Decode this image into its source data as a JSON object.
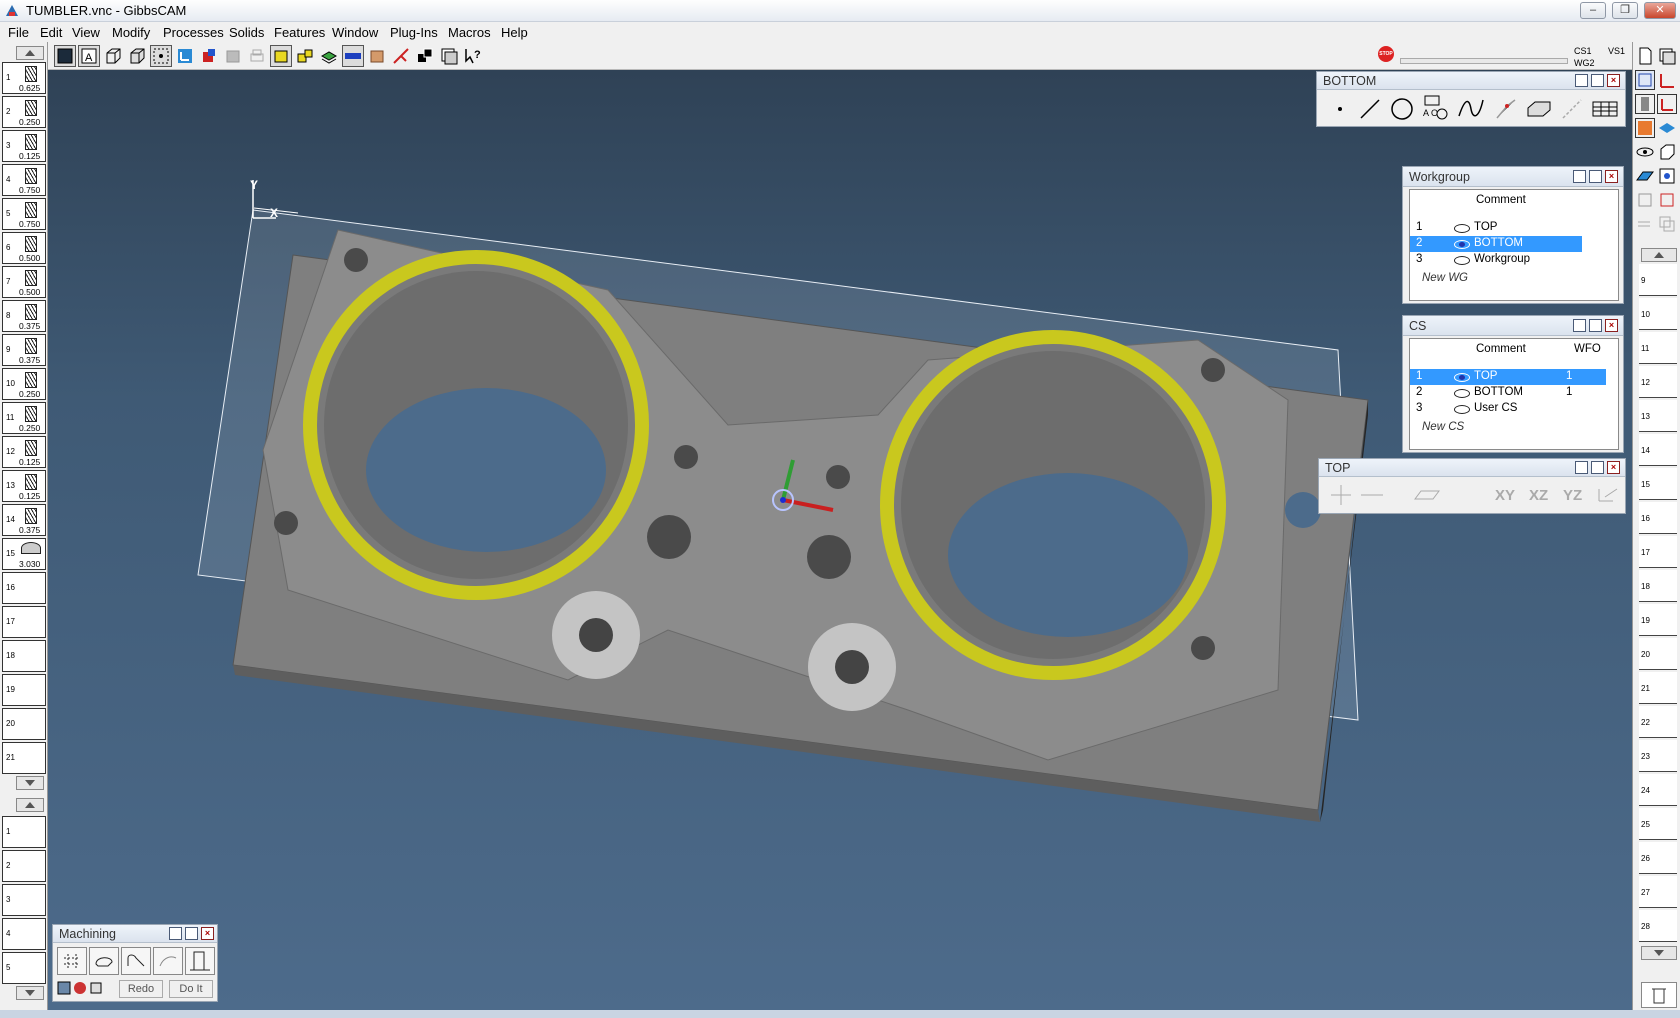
{
  "window": {
    "title": "TUMBLER.vnc - GibbsCAM",
    "min": "–",
    "max": "❐",
    "close": "✕"
  },
  "menu": [
    "File",
    "Edit",
    "View",
    "Modify",
    "Processes",
    "Solids",
    "Features",
    "Window",
    "Plug-Ins",
    "Macros",
    "Help"
  ],
  "status": {
    "stop": "STOP",
    "cs": "CS1",
    "wg": "WG2",
    "vs": "VS1"
  },
  "tools": [
    {
      "num": "1",
      "dia": "0.625"
    },
    {
      "num": "2",
      "dia": "0.250"
    },
    {
      "num": "3",
      "dia": "0.125"
    },
    {
      "num": "4",
      "dia": "0.750"
    },
    {
      "num": "5",
      "dia": "0.750"
    },
    {
      "num": "6",
      "dia": "0.500"
    },
    {
      "num": "7",
      "dia": "0.500"
    },
    {
      "num": "8",
      "dia": "0.375"
    },
    {
      "num": "9",
      "dia": "0.375"
    },
    {
      "num": "10",
      "dia": "0.250"
    },
    {
      "num": "11",
      "dia": "0.250"
    },
    {
      "num": "12",
      "dia": "0.125"
    },
    {
      "num": "13",
      "dia": "0.125"
    },
    {
      "num": "14",
      "dia": "0.375"
    },
    {
      "num": "15",
      "dia": "3.030"
    },
    {
      "num": "16",
      "dia": ""
    },
    {
      "num": "17",
      "dia": ""
    },
    {
      "num": "18",
      "dia": ""
    },
    {
      "num": "19",
      "dia": ""
    },
    {
      "num": "20",
      "dia": ""
    },
    {
      "num": "21",
      "dia": ""
    }
  ],
  "ops": [
    "1",
    "2",
    "3",
    "4",
    "5"
  ],
  "right_list": [
    "9",
    "10",
    "11",
    "12",
    "13",
    "14",
    "15",
    "16",
    "17",
    "18",
    "19",
    "20",
    "21",
    "22",
    "23",
    "24",
    "25",
    "26",
    "27",
    "28"
  ],
  "geometry_palette": {
    "title": "BOTTOM",
    "ao": "A O"
  },
  "workgroup": {
    "title": "Workgroup",
    "header": "Comment",
    "rows": [
      {
        "num": "1",
        "comment": "TOP",
        "selected": false
      },
      {
        "num": "2",
        "comment": "BOTTOM",
        "selected": true
      },
      {
        "num": "3",
        "comment": "Workgroup",
        "selected": false
      }
    ],
    "new": "New WG"
  },
  "cs": {
    "title": "CS",
    "header_comment": "Comment",
    "header_wfo": "WFO",
    "rows": [
      {
        "num": "1",
        "comment": "TOP",
        "wfo": "1",
        "selected": true
      },
      {
        "num": "2",
        "comment": "BOTTOM",
        "wfo": "1",
        "selected": false
      },
      {
        "num": "3",
        "comment": "User CS",
        "wfo": "",
        "selected": false
      }
    ],
    "new": "New CS"
  },
  "top_palette": {
    "title": "TOP",
    "xy": "XY",
    "xz": "XZ",
    "yz": "YZ"
  },
  "machining": {
    "title": "Machining",
    "redo": "Redo",
    "doit": "Do It"
  },
  "axes": {
    "x": "X",
    "y": "Y"
  },
  "colors": {
    "accent": "#3399ff",
    "ring": "#c9c81e",
    "part": "#8a8a8a"
  }
}
